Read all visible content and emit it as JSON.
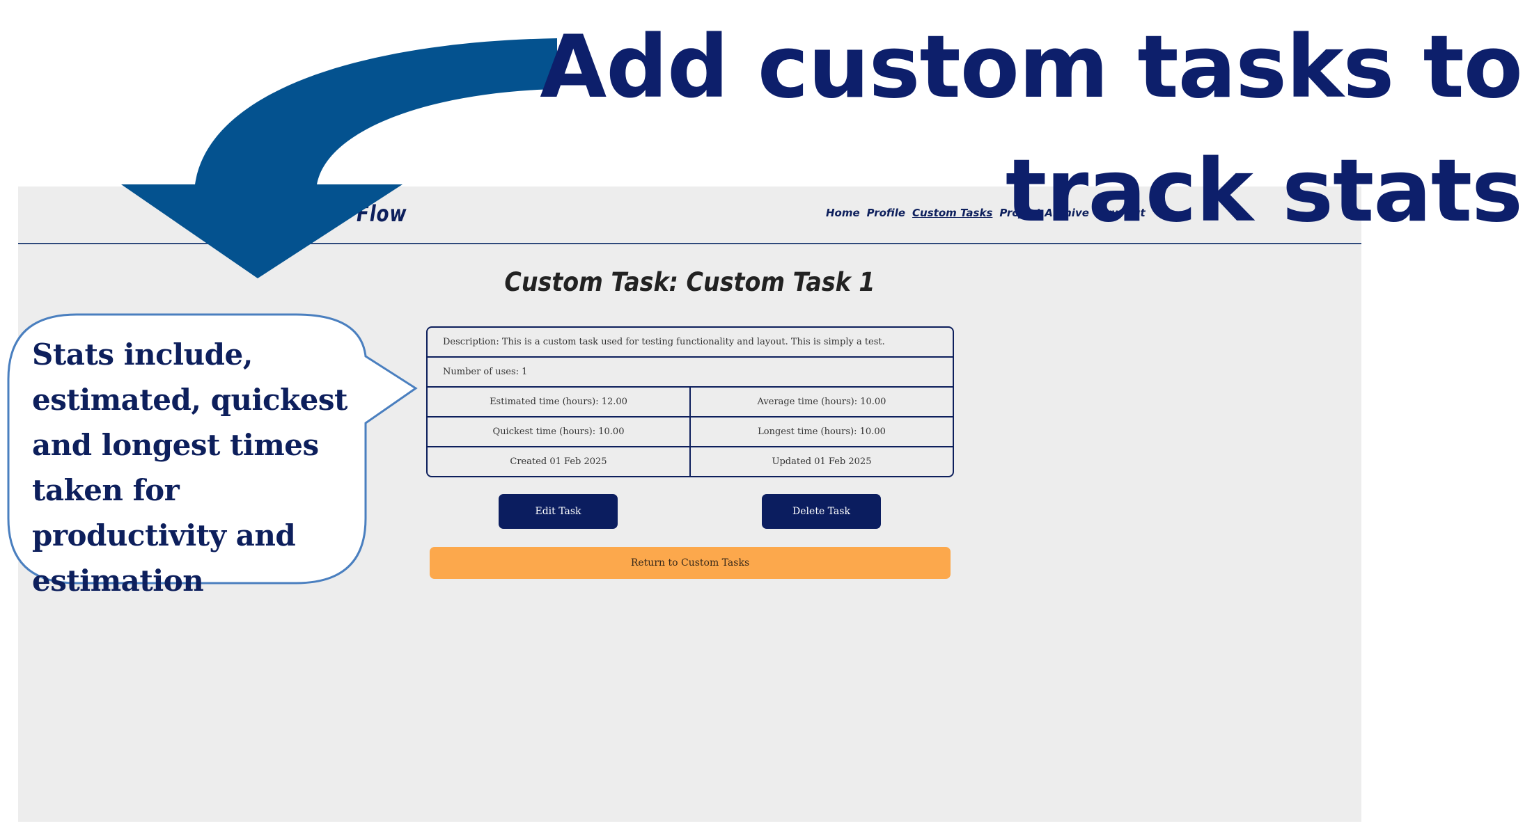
{
  "headline": {
    "line1": "Add custom tasks to",
    "line2": "track stats"
  },
  "callout": {
    "text": "Stats include, estimated, quickest and longest times taken for productivity and estimation"
  },
  "navbar": {
    "brand_partial": "Flow",
    "links": [
      "Home",
      "Profile",
      "Custom Tasks",
      "Project Archive",
      "Sign out"
    ],
    "active_link": "Custom Tasks"
  },
  "page": {
    "title": "Custom Task: Custom Task 1"
  },
  "task_details": {
    "description": "Description: This is a custom task used for testing functionality and layout. This is simply a test.",
    "uses": "Number of uses: 1",
    "estimated": "Estimated time (hours): 12.00",
    "average": "Average time (hours): 10.00",
    "quickest": "Quickest time (hours): 10.00",
    "longest": "Longest time (hours): 10.00",
    "created": "Created 01 Feb 2025",
    "updated": "Updated 01 Feb 2025"
  },
  "buttons": {
    "edit": "Edit Task",
    "delete": "Delete Task",
    "return": "Return to Custom Tasks"
  },
  "colors": {
    "navy": "#0d1f5c",
    "headline_navy": "#0d1f6b",
    "arrow_blue": "#04528f",
    "callout_border": "#4a7fbf",
    "return_orange": "#fca84c",
    "page_bg": "#ededed"
  }
}
